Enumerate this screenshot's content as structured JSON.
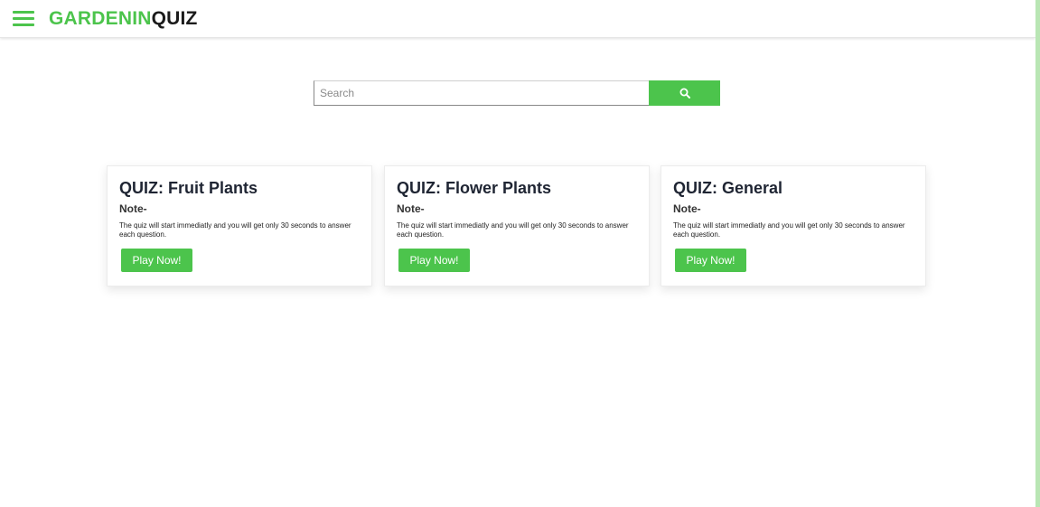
{
  "header": {
    "logo_part1": "GARDENIN",
    "logo_part2": "QUIZ",
    "menu_icon": "hamburger-menu-icon"
  },
  "search": {
    "placeholder": "Search",
    "value": "",
    "button_icon": "search-icon"
  },
  "cards": [
    {
      "title": "QUIZ: Fruit Plants",
      "note": "Note-",
      "description": "The quiz will start immediatly and you will get only 30 seconds to answer each question.",
      "button_label": "Play Now!"
    },
    {
      "title": "QUIZ: Flower Plants",
      "note": "Note-",
      "description": "The quiz will start immediatly and you will get only 30 seconds to answer each question.",
      "button_label": "Play Now!"
    },
    {
      "title": "QUIZ: General",
      "note": "Note-",
      "description": "The quiz will start immediatly and you will get only 30 seconds to answer each question.",
      "button_label": "Play Now!"
    }
  ],
  "colors": {
    "accent": "#4cc44c",
    "text_dark": "#1f2533"
  }
}
